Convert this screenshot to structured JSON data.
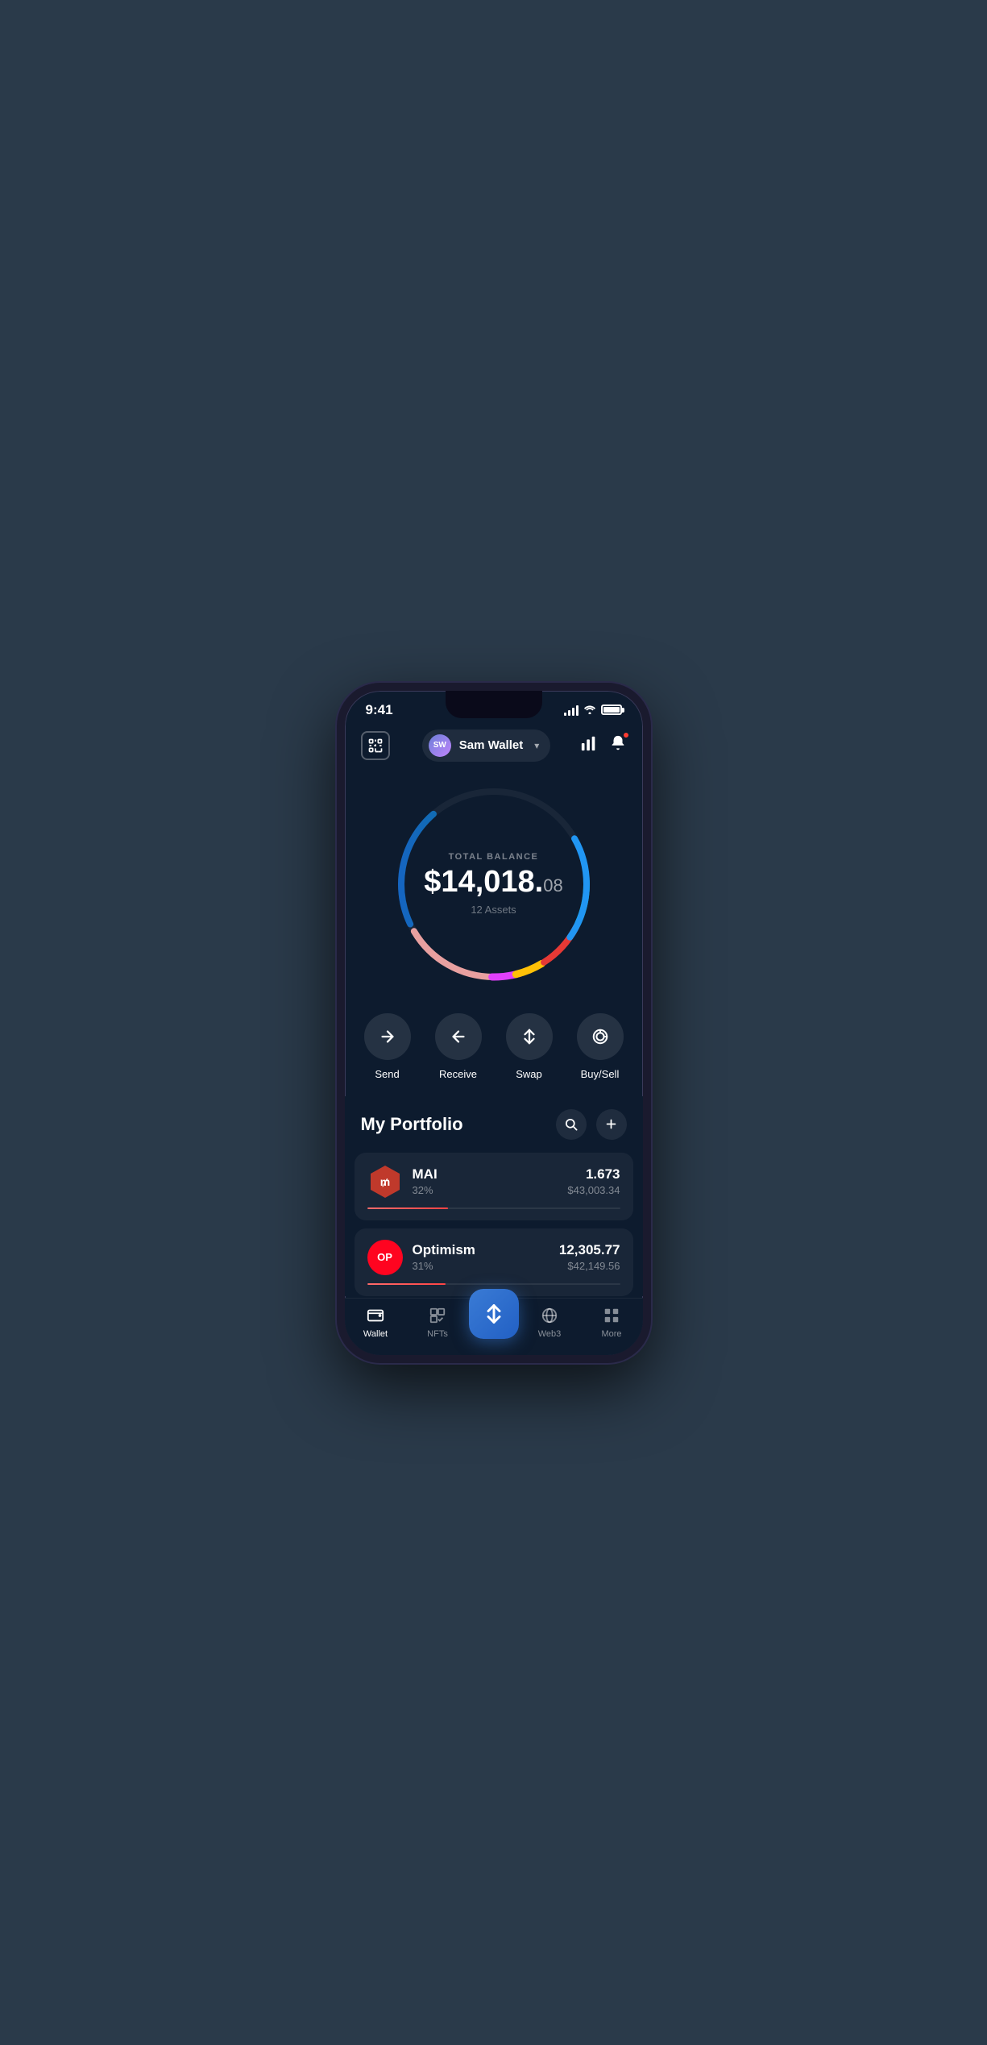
{
  "statusBar": {
    "time": "9:41"
  },
  "header": {
    "avatarInitials": "SW",
    "walletName": "Sam Wallet",
    "chevron": "▾",
    "scanLabel": "scan",
    "chartLabel": "chart",
    "bellLabel": "bell"
  },
  "balance": {
    "label": "TOTAL BALANCE",
    "whole": "$14,018.",
    "cents": "08",
    "assets": "12 Assets"
  },
  "actions": [
    {
      "id": "send",
      "label": "Send"
    },
    {
      "id": "receive",
      "label": "Receive"
    },
    {
      "id": "swap",
      "label": "Swap"
    },
    {
      "id": "buysell",
      "label": "Buy/Sell"
    }
  ],
  "portfolio": {
    "title": "My Portfolio",
    "items": [
      {
        "symbol": "MAI",
        "name": "MAI",
        "percent": "32%",
        "amount": "1.673",
        "usd": "$43,003.34",
        "progress": 32,
        "iconType": "mai"
      },
      {
        "symbol": "OP",
        "name": "Optimism",
        "percent": "31%",
        "amount": "12,305.77",
        "usd": "$42,149.56",
        "progress": 31,
        "iconType": "op"
      }
    ]
  },
  "bottomNav": {
    "items": [
      {
        "id": "wallet",
        "label": "Wallet",
        "active": true
      },
      {
        "id": "nfts",
        "label": "NFTs",
        "active": false
      },
      {
        "id": "center",
        "label": "",
        "active": false
      },
      {
        "id": "web3",
        "label": "Web3",
        "active": false
      },
      {
        "id": "more",
        "label": "More",
        "active": false
      }
    ]
  }
}
